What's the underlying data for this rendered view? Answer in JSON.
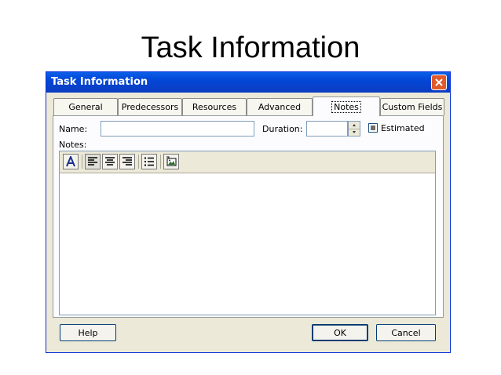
{
  "slide": {
    "title": "Task Information"
  },
  "dialog": {
    "title": "Task Information",
    "tabs": [
      {
        "label": "General",
        "active": false
      },
      {
        "label": "Predecessors",
        "active": false
      },
      {
        "label": "Resources",
        "active": false
      },
      {
        "label": "Advanced",
        "active": false
      },
      {
        "label": "Notes",
        "active": true
      },
      {
        "label": "Custom Fields",
        "active": false
      }
    ],
    "name_label": "Name:",
    "name_value": "",
    "duration_label": "Duration:",
    "duration_value": "",
    "estimated_label": "Estimated",
    "estimated_checked": true,
    "notes_label": "Notes:",
    "notes_text": "",
    "toolbar_icons": [
      "font-icon",
      "align-left-icon",
      "align-center-icon",
      "align-right-icon",
      "bullet-list-icon",
      "insert-object-icon"
    ],
    "buttons": {
      "help": "Help",
      "ok": "OK",
      "cancel": "Cancel"
    },
    "colors": {
      "titlebar": "#0a5fe8",
      "dialog_bg": "#ece9d8",
      "close": "#e05a2c"
    }
  }
}
